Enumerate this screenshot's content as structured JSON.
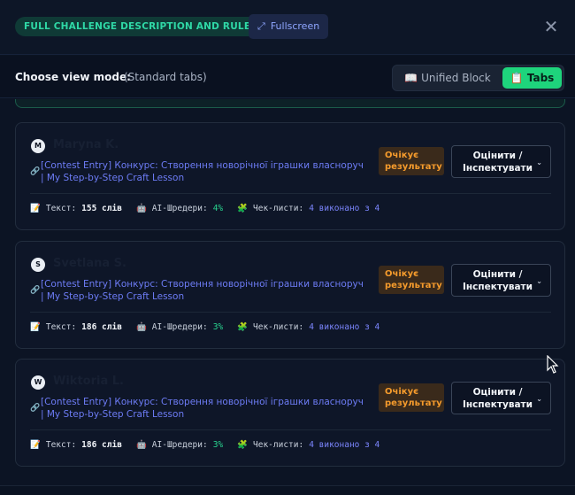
{
  "header": {
    "title": "FULL CHALLENGE DESCRIPTION AND RULES",
    "fullscreen_label": "Fullscreen",
    "close_symbol": "✕"
  },
  "view_mode": {
    "label": "Choose view mode:",
    "current": "(Standard tabs)",
    "options": [
      {
        "icon": "📖",
        "label": "Unified Block",
        "active": false
      },
      {
        "icon": "📋",
        "label": "Tabs",
        "active": true
      }
    ]
  },
  "stat_labels": {
    "text_icon": "📝",
    "text": "Текст:",
    "ai_icon": "🤖",
    "ai": "AI-Шредери:",
    "check_icon": "🧩",
    "check": "Чек-листи:"
  },
  "submissions": [
    {
      "avatar": "M",
      "author": "Maryna K.",
      "entry_title": "[Contest Entry] Конкурс: Створення новорічної іграшки власноруч | My Step-by-Step Craft Lesson",
      "status": "Очікує результату",
      "action": "Оцінити / Інспектувати",
      "text_value": "155 слів",
      "ai_value": "4%",
      "check_value": "4 виконано з 4"
    },
    {
      "avatar": "S",
      "author": "Svetlana S.",
      "entry_title": "[Contest Entry] Конкурс: Створення новорічної іграшки власноруч | My Step-by-Step Craft Lesson",
      "status": "Очікує результату",
      "action": "Оцінити / Інспектувати",
      "text_value": "186 слів",
      "ai_value": "3%",
      "check_value": "4 виконано з 4"
    },
    {
      "avatar": "W",
      "author": "Wiktoria L.",
      "entry_title": "[Contest Entry] Конкурс: Створення новорічної іграшки власноруч | My Step-by-Step Craft Lesson",
      "status": "Очікує результату",
      "action": "Оцінити / Інспектувати",
      "text_value": "186 слів",
      "ai_value": "3%",
      "check_value": "4 виконано з 4"
    }
  ],
  "colors": {
    "accent_green": "#1ed47c",
    "pending_orange": "#f59b2c",
    "link_blue": "#6d7cf6"
  }
}
